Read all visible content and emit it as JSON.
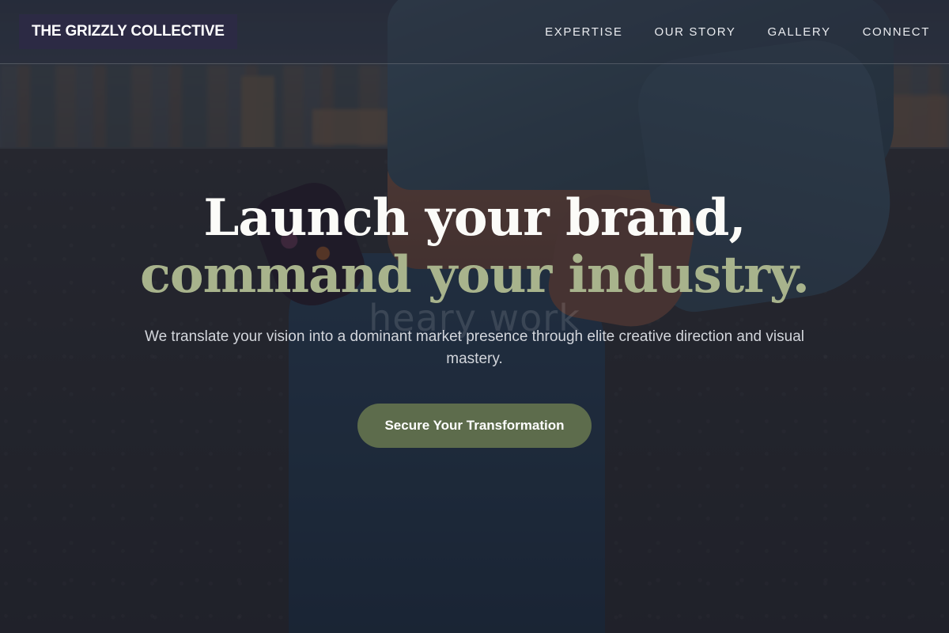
{
  "brand": {
    "name": "THE GRIZZLY COLLECTIVE"
  },
  "nav": {
    "items": [
      {
        "label": "EXPERTISE"
      },
      {
        "label": "OUR STORY"
      },
      {
        "label": "GALLERY"
      },
      {
        "label": "CONNECT"
      }
    ]
  },
  "hero": {
    "headline_line1": "Launch your brand,",
    "headline_line2": "command your industry.",
    "subtitle": "We translate your vision into a dominant market presence through elite creative direction and visual mastery.",
    "cta_label": "Secure Your Transformation",
    "background_watermark": "heary work"
  },
  "colors": {
    "logo_background": "#2c2a44",
    "accent_text": "#a8b38c",
    "cta_background": "#5d6c4c",
    "overlay": "#161822"
  }
}
